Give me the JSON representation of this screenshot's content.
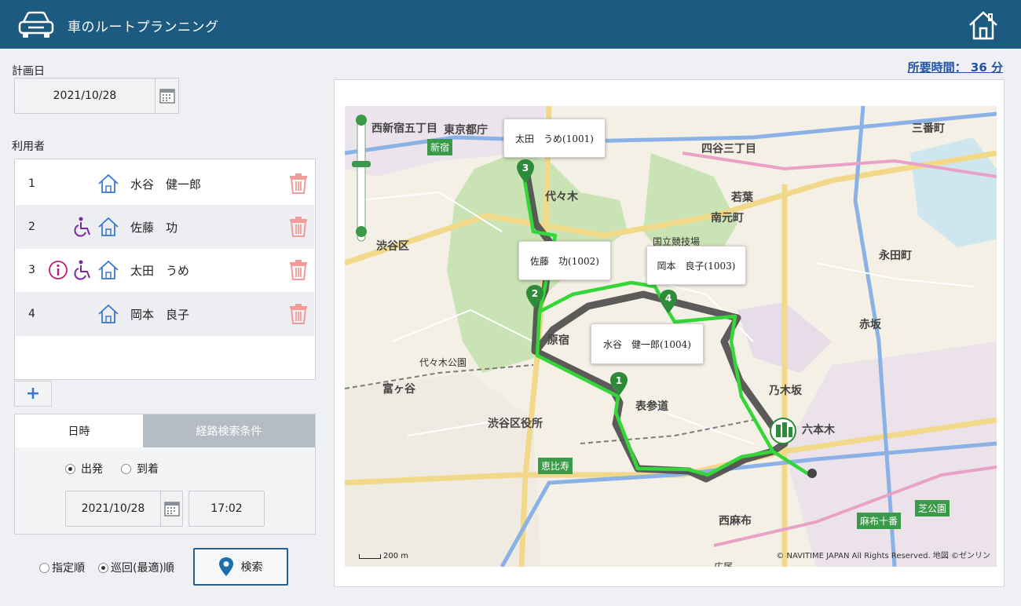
{
  "header": {
    "title": "車のルートプランニング"
  },
  "plan_date": {
    "label": "計画日",
    "value": "2021/10/28"
  },
  "users": {
    "label": "利用者",
    "rows": [
      {
        "num": "1",
        "name": "水谷　健一郎",
        "icons": [
          "home-icon"
        ]
      },
      {
        "num": "2",
        "name": "佐藤　功",
        "icons": [
          "wheelchair-icon",
          "home-icon"
        ]
      },
      {
        "num": "3",
        "name": "太田　うめ",
        "icons": [
          "info-icon",
          "wheelchair-icon",
          "home-icon"
        ]
      },
      {
        "num": "4",
        "name": "岡本　良子",
        "icons": [
          "home-icon"
        ]
      }
    ],
    "add_label": "+"
  },
  "tabs": {
    "datetime": "日時",
    "route_conditions": "経路検索条件"
  },
  "departure": {
    "depart_label": "出発",
    "arrive_label": "到着",
    "selected": "depart",
    "date": "2021/10/28",
    "time": "17:02"
  },
  "order": {
    "specified_label": "指定順",
    "optimal_label": "巡回(最適)順",
    "selected": "optimal"
  },
  "search_label": "検索",
  "duration": "所要時間： 36 分",
  "map": {
    "callouts": [
      {
        "id": "1",
        "text": "水谷　健一郎(1004)"
      },
      {
        "id": "2",
        "text": "佐藤　功(1002)"
      },
      {
        "id": "3",
        "text": "太田　うめ(1001)"
      },
      {
        "id": "4",
        "text": "岡本　良子(1003)"
      }
    ],
    "markers": [
      "1",
      "2",
      "3",
      "4"
    ],
    "labels": {
      "shibuya_ku": "渋谷区",
      "shibuya_office": "渋谷区役所",
      "yoyogi": "代々木",
      "harajuku": "原宿",
      "omotesando": "表参道",
      "nishi_shinjuku": "西新宿五丁目",
      "tokyo_tocho": "東京都庁",
      "yotsuya": "四谷三丁目",
      "minami_motomachi": "南元町",
      "aoyama": "乃木坂",
      "roppongi": "六本木",
      "nishi_azabu": "西麻布",
      "akasaka": "赤坂",
      "nagatacho": "永田町",
      "yoyogi_koen": "代々木公園",
      "kokuritsu": "国立競技場",
      "ebisu": "恵比寿",
      "hiroo": "広尾",
      "sanbancho": "三番町",
      "tomigaya": "富ヶ谷",
      "kasumigaoka": "若葉",
      "azabu_juban": "麻布十番",
      "shiba_koen": "芝公園",
      "keio": "新宿"
    },
    "scale": "200 m",
    "copyright": "© NAVITIME JAPAN All Rights Reserved. 地図 ©ゼンリン"
  },
  "colors": {
    "header_bg": "#1c5a80",
    "accent": "#1f52a8",
    "route_green": "#35d63a",
    "route_dark": "#4a4a4a",
    "marker_green": "#2e8b3a",
    "trash": "#f29b9b",
    "wheelchair": "#7a2a9c",
    "info": "#c2187a"
  }
}
